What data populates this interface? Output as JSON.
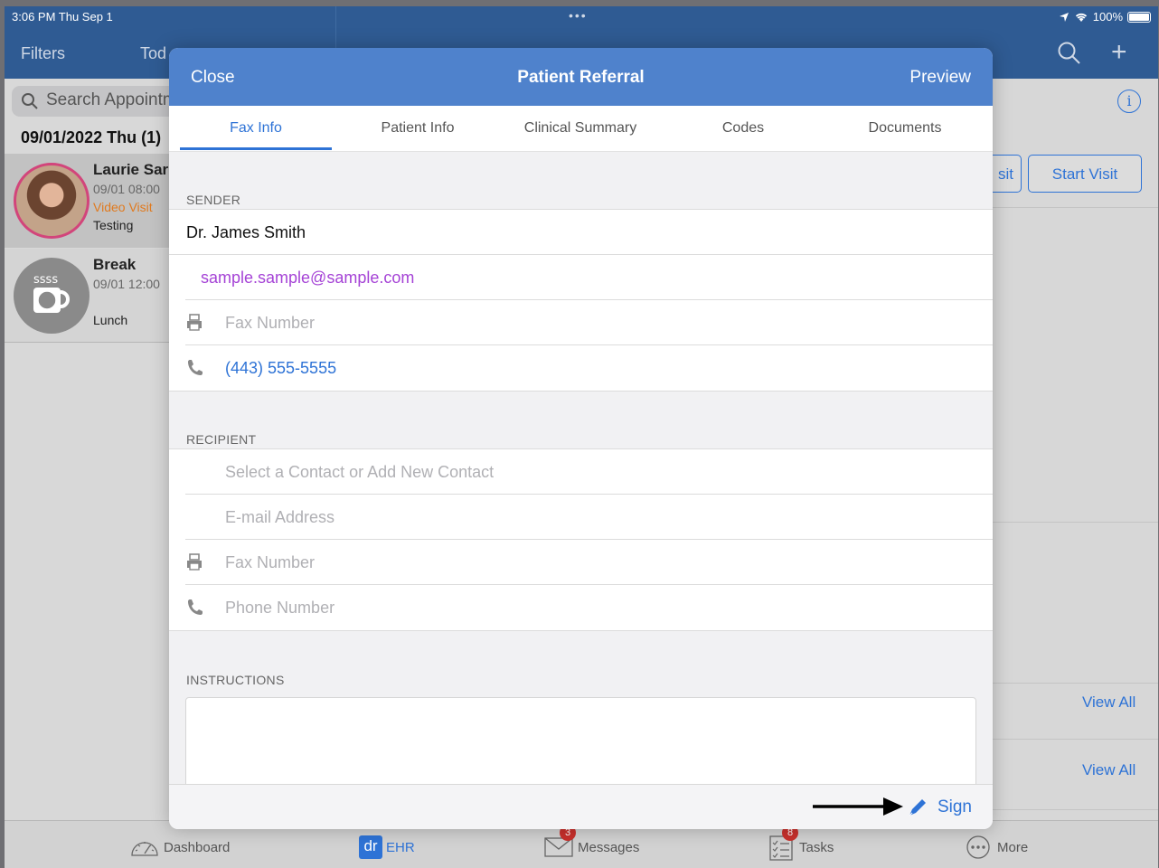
{
  "status": {
    "time": "3:06 PM  Thu Sep 1",
    "dots": "•••",
    "battery": "100%"
  },
  "nav": {
    "filters": "Filters",
    "today": "Tod"
  },
  "left": {
    "search_placeholder": "Search Appointm",
    "date_header": "09/01/2022 Thu (1)",
    "appointments": [
      {
        "name": "Laurie Sar",
        "time": "09/01 08:00",
        "type": "Video Visit",
        "note": "Testing"
      },
      {
        "name": "Break",
        "time": "09/01 12:00",
        "type": "",
        "note": "Lunch"
      }
    ]
  },
  "right": {
    "video_visit": "sit",
    "start_visit": "Start Visit",
    "view_all_1": "View All",
    "view_all_2": "View All"
  },
  "modal": {
    "close": "Close",
    "title": "Patient Referral",
    "preview": "Preview",
    "tabs": [
      "Fax Info",
      "Patient Info",
      "Clinical Summary",
      "Codes",
      "Documents"
    ],
    "active_tab": "Fax Info",
    "sender": {
      "label": "SENDER",
      "name": "Dr. James Smith",
      "email": "sample.sample@sample.com",
      "fax_placeholder": "Fax Number",
      "phone": "(443) 555-5555"
    },
    "recipient": {
      "label": "RECIPIENT",
      "contact_placeholder": "Select a Contact or Add New Contact",
      "email_placeholder": "E-mail Address",
      "fax_placeholder": "Fax Number",
      "phone_placeholder": "Phone Number"
    },
    "instructions": {
      "label": "INSTRUCTIONS",
      "value": ""
    },
    "sign": "Sign"
  },
  "tabbar": [
    {
      "label": "Dashboard",
      "icon": "dashboard-icon"
    },
    {
      "label": "EHR",
      "icon": "ehr-icon",
      "icon_text": "dr"
    },
    {
      "label": "Messages",
      "icon": "messages-icon",
      "badge": "3"
    },
    {
      "label": "Tasks",
      "icon": "tasks-icon",
      "badge": "8"
    },
    {
      "label": "More",
      "icon": "more-icon"
    }
  ],
  "colors": {
    "primary": "#2e73d6",
    "header": "#4f82cc",
    "nav": "#2f5b93",
    "email": "#a543d6",
    "badge": "#c9302c"
  }
}
